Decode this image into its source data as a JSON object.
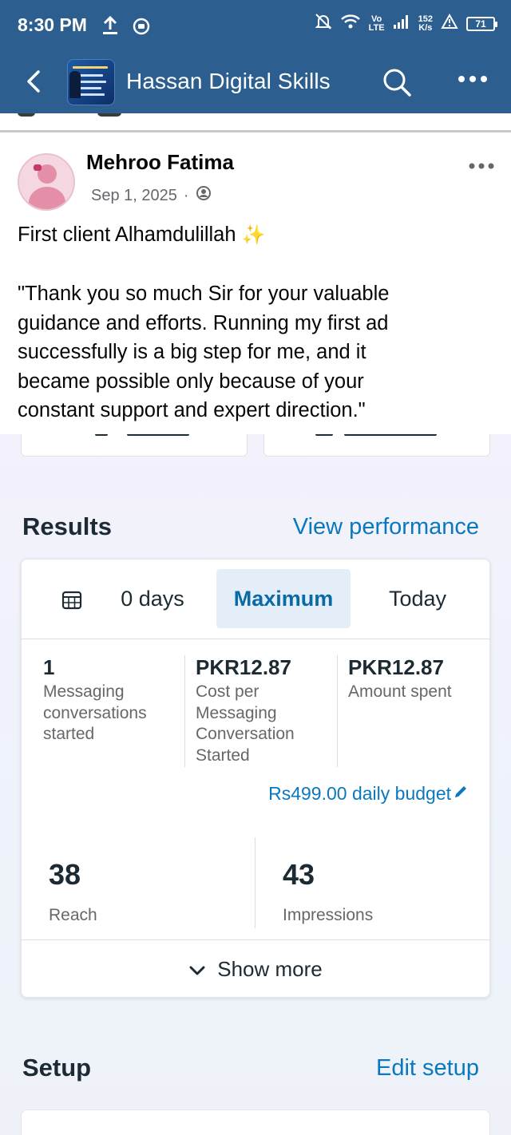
{
  "status_bar": {
    "time": "8:30 PM",
    "network_top": "Vo",
    "network_bottom": "LTE",
    "speed_top": "152",
    "speed_bottom": "K/s",
    "battery": "71",
    "icons": [
      "upload-icon",
      "app-notification-icon",
      "mute-icon",
      "wifi-icon",
      "signal-icon",
      "warning-icon",
      "battery-icon"
    ]
  },
  "header": {
    "group_title": "Hassan Digital Skills",
    "icons": [
      "back-arrow-icon",
      "search-icon",
      "more-horizontal-icon"
    ]
  },
  "post": {
    "author": "Mehroo Fatima",
    "date": "Sep 1, 2025",
    "separator": "·",
    "line1": "First client Alhamdulillah ",
    "sparkle": "✨",
    "quote_lines": [
      "\"Thank you so much Sir for your valuable",
      "guidance and efforts. Running my first ad",
      "successfully is a big step for me, and it",
      "became possible only because of your",
      "constant support and expert direction.\""
    ],
    "icons": [
      "privacy-icon",
      "post-options-icon"
    ]
  },
  "results": {
    "title": "Results",
    "link": "View performance",
    "tabs": {
      "custom": "0 days",
      "maximum": "Maximum",
      "today": "Today"
    },
    "metrics": [
      {
        "value": "1",
        "label_lines": [
          "Messaging",
          "conversations",
          "started"
        ]
      },
      {
        "value": "PKR12.87",
        "label_lines": [
          "Cost per",
          "Messaging",
          "Conversation",
          "Started"
        ]
      },
      {
        "value": "PKR12.87",
        "label_lines": [
          "Amount spent"
        ]
      }
    ],
    "budget": "Rs499.00 daily budget",
    "reach": {
      "value": "38",
      "label": "Reach"
    },
    "impressions": {
      "value": "43",
      "label": "Impressions"
    },
    "show_more": "Show more"
  },
  "setup": {
    "title": "Setup",
    "link": "Edit setup"
  },
  "colors": {
    "header_bg": "#2c5f8f",
    "link_blue": "#0a78be",
    "active_tab_bg": "#e3eef8"
  }
}
